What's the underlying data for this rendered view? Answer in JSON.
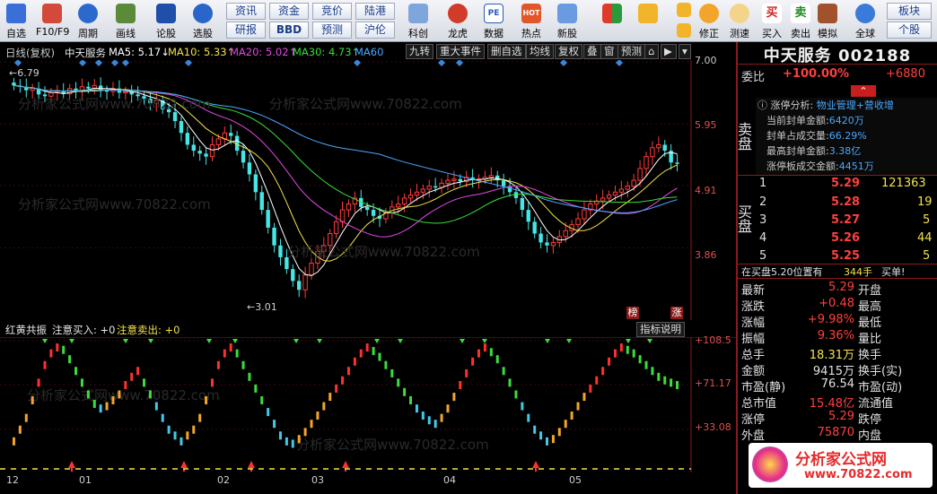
{
  "toolbar": {
    "buttons": [
      {
        "name": "self-select",
        "label": "自选"
      },
      {
        "name": "f10",
        "label": "F10/F9"
      },
      {
        "name": "period",
        "label": "周期"
      },
      {
        "name": "draw",
        "label": "画线"
      },
      {
        "name": "discuss",
        "label": "论股"
      },
      {
        "name": "stock-pick",
        "label": "选股"
      },
      {
        "name": "kline",
        "label": "科创"
      },
      {
        "name": "dragon-tiger",
        "label": "龙虎"
      },
      {
        "name": "data",
        "label": "数据"
      },
      {
        "name": "hotspot",
        "label": "热点"
      },
      {
        "name": "new-stock",
        "label": "新股"
      },
      {
        "name": "correct",
        "label": "修正"
      },
      {
        "name": "speed",
        "label": "测速"
      },
      {
        "name": "buy",
        "label": "买入"
      },
      {
        "name": "sell",
        "label": "卖出"
      },
      {
        "name": "simulate",
        "label": "模拟"
      },
      {
        "name": "global",
        "label": "全球"
      }
    ],
    "nav": [
      "资讯",
      "资金",
      "竞价",
      "陆港",
      "研报",
      "BBD",
      "预测",
      "沪伦"
    ],
    "plate": [
      "板块",
      "个股"
    ],
    "hot_icon_text": "HOT",
    "pe_icon_text": "PE"
  },
  "header": {
    "chart_type": "日线(复权)",
    "stock_name": "中天服务",
    "ma5": "MA5: 5.17↓",
    "ma10": "MA10: 5.33↑",
    "ma20": "MA20: 5.02↑",
    "ma30": "MA30: 4.73↑",
    "ma60": "MA60",
    "buttons": [
      "九转",
      "重大事件",
      "删自选",
      "均线",
      "复权",
      "叠",
      "窗",
      "预测"
    ]
  },
  "price_axis": [
    "7.00",
    "5.95",
    "4.91",
    "3.86"
  ],
  "price_markers": {
    "high": "6.79",
    "low": "3.01",
    "tag1": "榜",
    "tag2": "涨"
  },
  "lower": {
    "title": "红黄共振",
    "buy_label": "注意买入: +0",
    "sell_label": "注意卖出: +0",
    "explain_button": "指标说明",
    "axis": [
      "+108.5",
      "+71.17",
      "+33.08"
    ]
  },
  "date_axis": [
    "12",
    "01",
    "02",
    "03",
    "04",
    "05"
  ],
  "watermark": "分析家公式网www.70822.com",
  "right": {
    "title": "中天服务 002188",
    "weibi_label": "委比",
    "weibi_value": "+100.00%",
    "weicha_value": "+6880",
    "sell_label": "卖盘",
    "buy_label": "买盘",
    "limit_analysis_label": "涨停分析:",
    "limit_analysis_value": "物业管理+营收增",
    "limit_info": [
      {
        "label": "当前封单金额:",
        "value": "6420万"
      },
      {
        "label": "封单占成交量:",
        "value": "66.29%"
      },
      {
        "label": "最高封单金额:",
        "value": "3.38亿"
      },
      {
        "label": "涨停板成交金额:",
        "value": "4451万"
      }
    ],
    "bids": [
      {
        "level": "1",
        "price": "5.29",
        "vol": "121363"
      },
      {
        "level": "2",
        "price": "5.28",
        "vol": "19"
      },
      {
        "level": "3",
        "price": "5.27",
        "vol": "5"
      },
      {
        "level": "4",
        "price": "5.26",
        "vol": "44"
      },
      {
        "level": "5",
        "price": "5.25",
        "vol": "5"
      }
    ],
    "position_text": "在买盘5.20位置有",
    "position_vol": "344手",
    "position_tag": "买单!",
    "quote_left": [
      {
        "label": "最新",
        "value": "5.29"
      },
      {
        "label": "涨跌",
        "value": "+0.48"
      },
      {
        "label": "涨幅",
        "value": "+9.98%"
      },
      {
        "label": "振幅",
        "value": "9.36%"
      },
      {
        "label": "总手",
        "value": "18.31万"
      },
      {
        "label": "金额",
        "value": "9415万"
      },
      {
        "label": "市盈(静)",
        "value": "76.54"
      },
      {
        "label": "总市值",
        "value": "15.48亿"
      },
      {
        "label": "涨停",
        "value": "5.29"
      },
      {
        "label": "外盘",
        "value": "75870"
      }
    ],
    "quote_right": [
      "开盘",
      "最高",
      "最低",
      "量比",
      "换手",
      "换手(实)",
      "市盈(动)",
      "流通值",
      "跌停",
      "内盘"
    ],
    "logo_text": "分析家公式网",
    "logo_url": "www.70822.com"
  },
  "chart_data": [
    {
      "type": "candlestick",
      "title": "日线(复权) 中天服务",
      "y_axis_ticks": [
        7.0,
        5.95,
        4.91,
        3.86
      ],
      "annotated_high": 6.79,
      "annotated_low": 3.01,
      "close_series": [
        6.6,
        6.58,
        6.52,
        6.55,
        6.45,
        6.42,
        6.48,
        6.5,
        6.46,
        6.55,
        6.5,
        6.58,
        6.55,
        6.6,
        6.52,
        6.5,
        6.55,
        6.48,
        6.5,
        6.45,
        6.42,
        6.38,
        6.3,
        6.35,
        6.2,
        6.15,
        6.0,
        5.8,
        5.6,
        5.5,
        5.45,
        5.4,
        5.6,
        5.7,
        5.8,
        5.75,
        5.5,
        5.3,
        5.1,
        4.8,
        4.5,
        4.2,
        3.9,
        3.7,
        3.5,
        3.3,
        3.15,
        3.4,
        3.6,
        3.8,
        3.9,
        4.1,
        4.3,
        4.5,
        4.6,
        4.7,
        4.55,
        4.5,
        4.4,
        4.35,
        4.45,
        4.55,
        4.6,
        4.7,
        4.75,
        4.8,
        4.85,
        4.9,
        4.88,
        4.95,
        5.0,
        5.02,
        4.98,
        5.05,
        5.0,
        5.02,
        5.05,
        5.08,
        5.0,
        4.9,
        4.8,
        4.7,
        4.5,
        4.3,
        4.1,
        3.95,
        3.9,
        3.95,
        4.05,
        4.15,
        4.25,
        4.35,
        4.5,
        4.6,
        4.65,
        4.7,
        4.75,
        4.8,
        4.85,
        4.9,
        5.0,
        5.2,
        5.4,
        5.55,
        5.6,
        5.5,
        5.3,
        5.29
      ],
      "ma_series": [
        {
          "name": "MA5",
          "value": 5.17
        },
        {
          "name": "MA10",
          "value": 5.33
        },
        {
          "name": "MA20",
          "value": 5.02
        },
        {
          "name": "MA30",
          "value": 4.73
        },
        {
          "name": "MA60"
        }
      ],
      "x_labels": [
        "12",
        "01",
        "02",
        "03",
        "04",
        "05"
      ]
    },
    {
      "type": "bar",
      "title": "红黄共振",
      "y_axis_ticks": [
        108.5,
        71.17,
        33.08
      ],
      "values": [
        20,
        30,
        40,
        55,
        70,
        85,
        95,
        100,
        98,
        90,
        80,
        70,
        60,
        52,
        48,
        50,
        55,
        60,
        68,
        75,
        80,
        70,
        60,
        50,
        40,
        30,
        25,
        20,
        25,
        30,
        40,
        55,
        70,
        85,
        95,
        100,
        95,
        85,
        75,
        65,
        55,
        45,
        35,
        25,
        20,
        18,
        22,
        28,
        35,
        42,
        50,
        58,
        65,
        72,
        80,
        88,
        95,
        100,
        97,
        92,
        85,
        78,
        70,
        62,
        55,
        48,
        42,
        38,
        35,
        40,
        48,
        58,
        68,
        78,
        88,
        95,
        100,
        96,
        90,
        80,
        70,
        60,
        50,
        40,
        30,
        25,
        20,
        22,
        28,
        35,
        42,
        50,
        58,
        65,
        72,
        80,
        88,
        95,
        100,
        98,
        95,
        90,
        85,
        80,
        75,
        72,
        70,
        68
      ]
    }
  ]
}
